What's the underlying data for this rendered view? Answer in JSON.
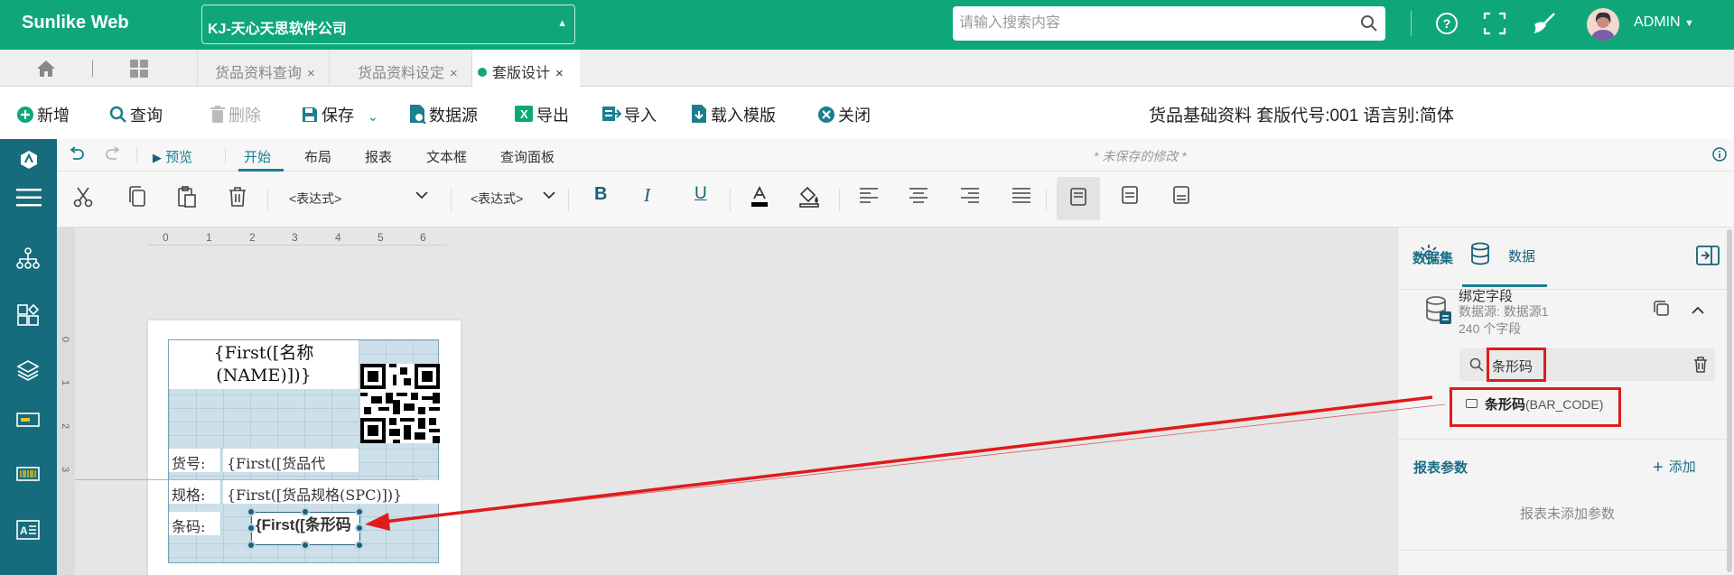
{
  "topbar": {
    "brand": "Sunlike Web",
    "company": "KJ-天心天思软件公司",
    "search_placeholder": "请输入搜索内容",
    "user": "ADMIN"
  },
  "tabs": [
    {
      "label": "货品资料查询"
    },
    {
      "label": "货品资料设定"
    },
    {
      "label": "套版设计",
      "active": true
    }
  ],
  "actions": {
    "new": "新增",
    "query": "查询",
    "delete": "删除",
    "save": "保存",
    "datasource": "数据源",
    "export": "导出",
    "import": "导入",
    "load_template": "载入模版",
    "close": "关闭",
    "doc_title": "货品基础资料 套版代号:001 语言别:简体"
  },
  "ribbon": {
    "preview": "预览",
    "tabs": [
      "开始",
      "布局",
      "报表",
      "文本框",
      "查询面板"
    ],
    "unsaved": "* 未保存的修改 *",
    "expr1": "<表达式>",
    "expr2": "<表达式>"
  },
  "ruler": {
    "h": [
      "0",
      "1",
      "2",
      "3",
      "4",
      "5",
      "6"
    ],
    "v": [
      "0",
      "1",
      "2",
      "3"
    ]
  },
  "label": {
    "name_field": "{First([名称(NAME)])}",
    "name_line1": "{First([名称",
    "name_line2": "(NAME)])}",
    "rows": [
      {
        "label": "货号:",
        "value": "{First([货品代"
      },
      {
        "label": "规格:",
        "value": "{First([货品规格(SPC)])}"
      },
      {
        "label": "条码:",
        "value": ""
      }
    ],
    "barcode_text": "{First([条形码"
  },
  "panel": {
    "settings_tab": "",
    "data_tab": "数据",
    "dataset_section": "数据集",
    "binding_title": "绑定字段",
    "binding_source": "数据源: 数据源1",
    "binding_count": "240 个字段",
    "field_search": "条形码",
    "field_name": "条形码",
    "field_code": "(BAR_CODE)",
    "params_section": "报表参数",
    "add": "添加",
    "no_params": "报表未添加参数"
  },
  "colors": {
    "brand_green": "#0fa779",
    "sidebar": "#166c7d",
    "accent": "#1a7f8f",
    "annotation_red": "#e01b1b"
  }
}
